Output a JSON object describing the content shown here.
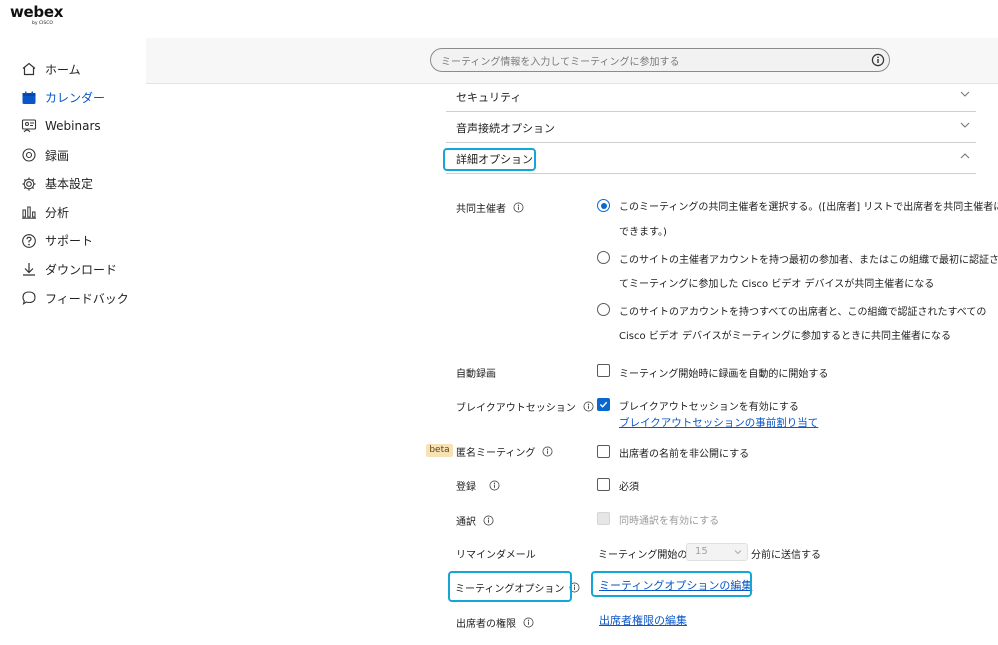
{
  "brand": {
    "name": "webex",
    "by": "by CISCO"
  },
  "sidebar": {
    "items": [
      {
        "label": "ホーム",
        "icon": "home-icon"
      },
      {
        "label": "カレンダー",
        "icon": "calendar-icon",
        "active": true
      },
      {
        "label": "Webinars",
        "icon": "webinar-icon"
      },
      {
        "label": "録画",
        "icon": "record-icon"
      },
      {
        "label": "基本設定",
        "icon": "gear-icon"
      },
      {
        "label": "分析",
        "icon": "analytics-icon"
      },
      {
        "label": "サポート",
        "icon": "help-icon"
      },
      {
        "label": "ダウンロード",
        "icon": "download-icon"
      },
      {
        "label": "フィードバック",
        "icon": "feedback-icon"
      }
    ]
  },
  "search": {
    "placeholder": "ミーティング情報を入力してミーティングに参加する"
  },
  "sections": {
    "security": "セキュリティ",
    "audio": "音声接続オプション",
    "advanced": "詳細オプション"
  },
  "cohost": {
    "label": "共同主催者",
    "option1_line1": "このミーティングの共同主催者を選択する。([出席者] リストで出席者を共同主催者に",
    "option1_line2": "できます。)",
    "option2_line1": "このサイトの主催者アカウントを持つ最初の参加者、またはこの組織で最初に認証され",
    "option2_line2": "てミーティングに参加した Cisco ビデオ デバイスが共同主催者になる",
    "option3_line1": "このサイトのアカウントを持つすべての出席者と、この組織で認証されたすべての",
    "option3_line2": "Cisco ビデオ デバイスがミーティングに参加するときに共同主催者になる"
  },
  "auto_record": {
    "label": "自動録画",
    "option": "ミーティング開始時に録画を自動的に開始する"
  },
  "breakout": {
    "label": "ブレイクアウトセッション",
    "option": "ブレイクアウトセッションを有効にする",
    "link": "ブレイクアウトセッションの事前割り当て"
  },
  "anonymous": {
    "badge": "beta",
    "label": "匿名ミーティング",
    "option": "出席者の名前を非公開にする"
  },
  "registration": {
    "label": "登録",
    "option": "必須"
  },
  "interpretation": {
    "label": "通訳",
    "option": "同時通訳を有効にする"
  },
  "reminder": {
    "label": "リマインダメール",
    "prefix": "ミーティング開始の",
    "value": "15",
    "suffix": "分前に送信する"
  },
  "meeting_options": {
    "label": "ミーティングオプション",
    "link": "ミーティングオプションの編集"
  },
  "attendee_privileges": {
    "label": "出席者の権限",
    "link": "出席者権限の編集"
  },
  "colors": {
    "accent": "#0a56c7",
    "highlight": "#14a6d9",
    "beta_bg": "#f8e2b5"
  }
}
